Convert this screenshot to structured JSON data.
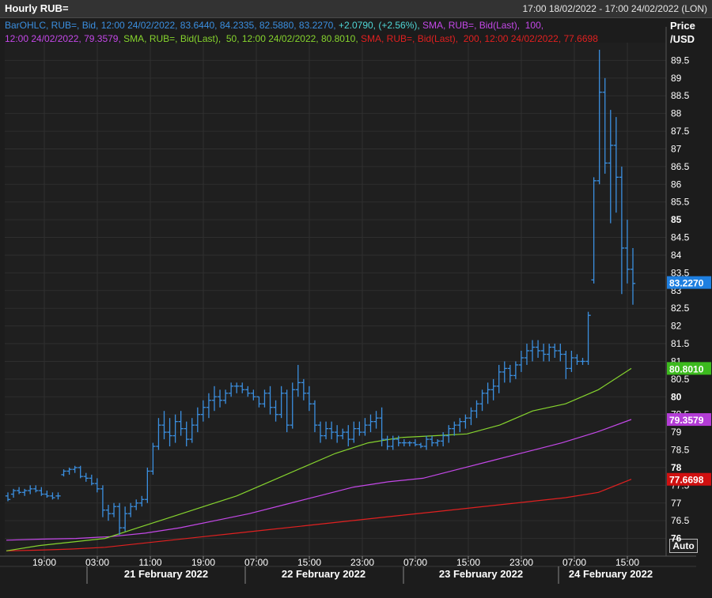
{
  "header": {
    "title": "Hourly RUB=",
    "time_range": "17:00 18/02/2022 - 17:00 24/02/2022 (LON)"
  },
  "legend": {
    "line1": [
      {
        "text": "BarOHLC, RUB=, Bid, 12:00 24/02/2022, 83.6440, 84.2335, 82.5880, 83.2270,",
        "color": "#3b8fe0"
      },
      {
        "text": " +2.0790, (+2.56%),",
        "color": "#4fd6d6"
      },
      {
        "text": " SMA, RUB=, Bid(Last),  100,",
        "color": "#c448e8"
      }
    ],
    "line2": [
      {
        "text": "12:00 24/02/2022, 79.3579,",
        "color": "#c448e8"
      },
      {
        "text": " SMA, RUB=, Bid(Last),  50, 12:00 24/02/2022, 80.8010,",
        "color": "#86d42e"
      },
      {
        "text": " SMA, RUB=, Bid(Last),  200, 12:00 24/02/2022, 77.6698",
        "color": "#e02020"
      }
    ]
  },
  "price_axis": {
    "header_line1": "Price",
    "header_line2": "/USD",
    "auto_label": "Auto"
  },
  "colors": {
    "bars": "#3b8fe0",
    "sma50": "#86d42e",
    "sma100": "#c448e8",
    "sma200": "#e02020",
    "last_price_tag": "#1e7fe0"
  },
  "chart_data": {
    "type": "ohlc",
    "ylim": [
      75.5,
      90
    ],
    "y_ticks": [
      76,
      76.5,
      77,
      77.5,
      78,
      78.5,
      79,
      79.5,
      80,
      80.5,
      81,
      81.5,
      82,
      82.5,
      83,
      83.5,
      84,
      84.5,
      85,
      85.5,
      86,
      86.5,
      87,
      87.5,
      88,
      88.5,
      89,
      89.5
    ],
    "y_tick_labels": [
      "76",
      "76.5",
      "77",
      "77.5",
      "78",
      "78.5",
      "79",
      "79.5",
      "80",
      "80.5",
      "81",
      "81.5",
      "82",
      "82.5",
      "83",
      "83.5",
      "84",
      "84.5",
      "85",
      "85.5",
      "86",
      "86.5",
      "87",
      "87.5",
      "88",
      "88.5",
      "89",
      "89.5"
    ],
    "y_bold": [
      "76",
      "78",
      "80",
      "85"
    ],
    "x_time_labels": [
      "19:00",
      "03:00",
      "11:00",
      "19:00",
      "07:00",
      "15:00",
      "23:00",
      "07:00",
      "15:00",
      "23:00",
      "07:00",
      "15:00"
    ],
    "date_labels": [
      "21 February 2022",
      "22 February 2022",
      "23 February 2022",
      "24 February 2022"
    ],
    "bar_interval": "1 hour",
    "ohlc": [
      [
        77.2,
        77.3,
        77.05,
        77.1
      ],
      [
        77.25,
        77.4,
        77.15,
        77.35
      ],
      [
        77.35,
        77.45,
        77.25,
        77.3
      ],
      [
        77.3,
        77.4,
        77.2,
        77.35
      ],
      [
        77.35,
        77.5,
        77.25,
        77.4
      ],
      [
        77.4,
        77.5,
        77.3,
        77.35
      ],
      [
        77.35,
        77.45,
        77.2,
        77.25
      ],
      [
        77.25,
        77.35,
        77.15,
        77.2
      ],
      [
        77.2,
        77.3,
        77.1,
        77.15
      ],
      [
        77.2,
        77.3,
        77.1,
        77.2
      ],
      [
        77.8,
        77.95,
        77.75,
        77.9
      ],
      [
        77.9,
        78.0,
        77.8,
        77.95
      ],
      [
        77.95,
        78.05,
        77.85,
        78.0
      ],
      [
        78.0,
        78.05,
        77.7,
        77.75
      ],
      [
        77.75,
        77.85,
        77.6,
        77.7
      ],
      [
        77.7,
        77.8,
        77.5,
        77.55
      ],
      [
        77.55,
        77.7,
        77.3,
        77.4
      ],
      [
        77.4,
        77.5,
        76.6,
        76.8
      ],
      [
        76.8,
        76.95,
        76.5,
        76.7
      ],
      [
        76.7,
        77.0,
        76.6,
        76.9
      ],
      [
        76.9,
        77.0,
        76.1,
        76.3
      ],
      [
        76.3,
        76.9,
        76.2,
        76.7
      ],
      [
        76.7,
        77.0,
        76.6,
        76.9
      ],
      [
        76.9,
        77.1,
        76.8,
        77.0
      ],
      [
        77.0,
        77.2,
        76.9,
        77.1
      ],
      [
        77.1,
        78.0,
        77.0,
        77.9
      ],
      [
        77.9,
        78.7,
        77.8,
        78.6
      ],
      [
        78.6,
        79.4,
        78.5,
        79.2
      ],
      [
        79.2,
        79.6,
        78.8,
        79.0
      ],
      [
        79.0,
        79.4,
        78.6,
        78.9
      ],
      [
        78.9,
        79.5,
        78.7,
        79.3
      ],
      [
        79.3,
        79.6,
        78.9,
        79.1
      ],
      [
        79.1,
        79.3,
        78.6,
        78.8
      ],
      [
        78.8,
        79.4,
        78.7,
        79.2
      ],
      [
        79.2,
        79.7,
        79.0,
        79.5
      ],
      [
        79.5,
        79.9,
        79.3,
        79.7
      ],
      [
        79.7,
        80.1,
        79.4,
        79.9
      ],
      [
        79.9,
        80.3,
        79.6,
        80.0
      ],
      [
        80.0,
        80.2,
        79.7,
        79.9
      ],
      [
        79.9,
        80.2,
        79.8,
        80.1
      ],
      [
        80.1,
        80.4,
        80.0,
        80.3
      ],
      [
        80.3,
        80.4,
        80.1,
        80.3
      ],
      [
        80.3,
        80.4,
        80.1,
        80.2
      ],
      [
        80.2,
        80.3,
        80.0,
        80.1
      ],
      [
        80.1,
        80.2,
        79.9,
        80.0
      ],
      [
        80.0,
        80.0,
        79.7,
        79.8
      ],
      [
        79.8,
        80.2,
        79.7,
        80.1
      ],
      [
        80.1,
        80.3,
        79.5,
        79.7
      ],
      [
        79.7,
        79.9,
        79.3,
        79.5
      ],
      [
        79.5,
        80.3,
        79.4,
        80.1
      ],
      [
        80.1,
        80.2,
        79.0,
        79.2
      ],
      [
        79.2,
        80.4,
        79.1,
        80.2
      ],
      [
        80.2,
        80.9,
        80.0,
        80.4
      ],
      [
        80.4,
        80.5,
        79.9,
        80.1
      ],
      [
        80.1,
        80.3,
        79.6,
        79.8
      ],
      [
        79.8,
        79.9,
        79.0,
        79.2
      ],
      [
        79.2,
        79.3,
        78.7,
        78.9
      ],
      [
        78.9,
        79.3,
        78.8,
        79.1
      ],
      [
        79.1,
        79.3,
        78.8,
        79.0
      ],
      [
        79.0,
        79.2,
        78.7,
        78.9
      ],
      [
        78.9,
        79.1,
        78.8,
        79.0
      ],
      [
        79.0,
        79.2,
        78.6,
        78.8
      ],
      [
        78.8,
        79.3,
        78.7,
        79.1
      ],
      [
        79.1,
        79.3,
        78.9,
        79.0
      ],
      [
        79.0,
        79.4,
        78.9,
        79.2
      ],
      [
        79.2,
        79.5,
        79.0,
        79.3
      ],
      [
        79.3,
        79.6,
        79.1,
        79.4
      ],
      [
        79.4,
        79.7,
        78.6,
        78.8
      ],
      [
        78.8,
        78.9,
        78.5,
        78.6
      ],
      [
        78.6,
        78.9,
        78.5,
        78.8
      ],
      [
        78.8,
        78.9,
        78.6,
        78.7
      ],
      [
        78.7,
        78.8,
        78.6,
        78.7
      ],
      [
        78.7,
        78.75,
        78.6,
        78.7
      ],
      [
        78.7,
        78.8,
        78.6,
        78.65
      ],
      [
        78.65,
        78.7,
        78.55,
        78.6
      ],
      [
        78.6,
        78.9,
        78.5,
        78.8
      ],
      [
        78.8,
        78.9,
        78.6,
        78.7
      ],
      [
        78.7,
        78.8,
        78.6,
        78.75
      ],
      [
        78.75,
        79.0,
        78.6,
        78.9
      ],
      [
        78.9,
        79.2,
        78.7,
        79.1
      ],
      [
        79.1,
        79.3,
        78.9,
        79.2
      ],
      [
        79.2,
        79.4,
        79.0,
        79.3
      ],
      [
        79.3,
        79.5,
        79.1,
        79.4
      ],
      [
        79.4,
        79.7,
        79.2,
        79.6
      ],
      [
        79.6,
        79.9,
        79.4,
        79.8
      ],
      [
        79.8,
        80.2,
        79.6,
        80.1
      ],
      [
        80.1,
        80.4,
        79.8,
        80.2
      ],
      [
        80.2,
        80.5,
        79.9,
        80.3
      ],
      [
        80.3,
        80.9,
        80.1,
        80.7
      ],
      [
        80.7,
        81.0,
        80.4,
        80.8
      ],
      [
        80.8,
        80.9,
        80.4,
        80.6
      ],
      [
        80.6,
        81.0,
        80.5,
        80.9
      ],
      [
        80.9,
        81.3,
        80.7,
        81.1
      ],
      [
        81.1,
        81.5,
        80.9,
        81.3
      ],
      [
        81.3,
        81.6,
        81.0,
        81.4
      ],
      [
        81.4,
        81.6,
        81.1,
        81.3
      ],
      [
        81.3,
        81.5,
        81.0,
        81.2
      ],
      [
        81.2,
        81.5,
        81.0,
        81.4
      ],
      [
        81.4,
        81.5,
        81.1,
        81.3
      ],
      [
        81.3,
        81.5,
        81.0,
        81.2
      ],
      [
        81.2,
        81.3,
        80.5,
        80.8
      ],
      [
        80.8,
        81.3,
        80.7,
        81.1
      ],
      [
        81.1,
        81.2,
        80.9,
        81.0
      ],
      [
        81.0,
        81.1,
        80.9,
        81.0
      ],
      [
        81.0,
        82.4,
        80.9,
        82.3
      ],
      [
        83.3,
        86.2,
        83.2,
        86.1
      ],
      [
        86.1,
        89.8,
        86.0,
        88.6
      ],
      [
        88.6,
        89.0,
        86.3,
        86.6
      ],
      [
        86.6,
        88.1,
        84.9,
        87.1
      ],
      [
        87.1,
        87.9,
        85.2,
        86.2
      ],
      [
        86.2,
        86.5,
        82.9,
        84.2
      ],
      [
        84.2,
        85.0,
        83.2,
        83.6
      ],
      [
        83.6,
        84.2,
        82.6,
        83.2
      ]
    ],
    "sma50_values": [
      75.65,
      75.8,
      75.9,
      76.0,
      76.3,
      76.6,
      76.9,
      77.2,
      77.6,
      78.0,
      78.4,
      78.7,
      78.85,
      78.9,
      78.95,
      79.2,
      79.6,
      79.8,
      80.2,
      80.8
    ],
    "sma100_values": [
      75.95,
      75.98,
      76.0,
      76.05,
      76.15,
      76.3,
      76.5,
      76.7,
      76.95,
      77.2,
      77.45,
      77.6,
      77.7,
      77.95,
      78.2,
      78.45,
      78.7,
      79.0,
      79.36
    ],
    "sma200_values": [
      75.65,
      75.67,
      75.7,
      75.75,
      75.85,
      75.95,
      76.05,
      76.15,
      76.25,
      76.35,
      76.45,
      76.55,
      76.65,
      76.75,
      76.85,
      76.95,
      77.05,
      77.15,
      77.3,
      77.67
    ],
    "last_values": [
      {
        "label": "83.2270",
        "value": 83.227,
        "color": "#1e7fe0"
      },
      {
        "label": "80.8010",
        "value": 80.801,
        "color": "#3cba1e"
      },
      {
        "label": "79.3579",
        "value": 79.3579,
        "color": "#b33cd6"
      },
      {
        "label": "77.6698",
        "value": 77.6698,
        "color": "#d01010"
      }
    ]
  }
}
